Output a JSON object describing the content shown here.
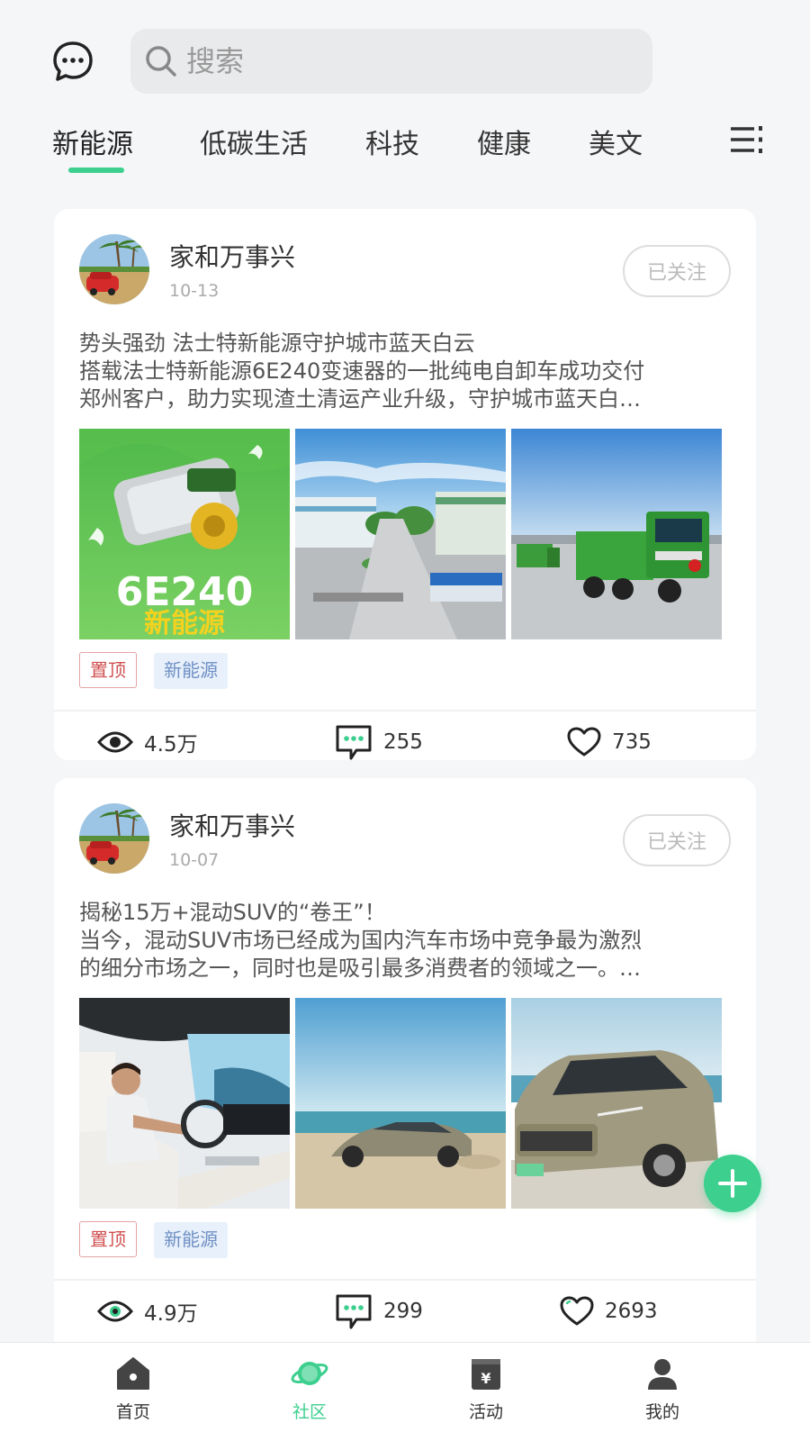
{
  "header": {
    "search_placeholder": "搜索"
  },
  "tabs": [
    {
      "label": "新能源",
      "active": true
    },
    {
      "label": "低碳生活",
      "active": false
    },
    {
      "label": "科技",
      "active": false
    },
    {
      "label": "健康",
      "active": false
    },
    {
      "label": "美文",
      "active": false
    }
  ],
  "posts": [
    {
      "author": "家和万事兴",
      "date": "10-13",
      "follow_label": "已关注",
      "title": "势头强劲 法士特新能源守护城市蓝天白云",
      "body_line1": "搭载法士特新能源6E240变速器的一批纯电自卸车成功交付",
      "body_line2": "郑州客户，助力实现渣土清运产业升级，守护城市蓝天白…",
      "image_text_line1": "6E240",
      "image_text_line2": "新能源",
      "tag_pin": "置顶",
      "tag_category": "新能源",
      "views": "4.5万",
      "comments": "255",
      "likes": "735"
    },
    {
      "author": "家和万事兴",
      "date": "10-07",
      "follow_label": "已关注",
      "title": "揭秘15万+混动SUV的“卷王”！",
      "body_line1": "当今，混动SUV市场已经成为国内汽车市场中竞争最为激烈",
      "body_line2": "的细分市场之一，同时也是吸引最多消费者的领域之一。…",
      "tag_pin": "置顶",
      "tag_category": "新能源",
      "views": "4.9万",
      "comments": "299",
      "likes": "2693"
    }
  ],
  "bottom_nav": [
    {
      "label": "首页",
      "icon": "home-icon",
      "active": false
    },
    {
      "label": "社区",
      "icon": "planet-icon",
      "active": true
    },
    {
      "label": "活动",
      "icon": "activity-icon",
      "active": false
    },
    {
      "label": "我的",
      "icon": "user-icon",
      "active": false
    }
  ],
  "colors": {
    "accent": "#3ccf8e",
    "pin_tag": "#d05050",
    "category_tag": "#6e8fc4"
  }
}
